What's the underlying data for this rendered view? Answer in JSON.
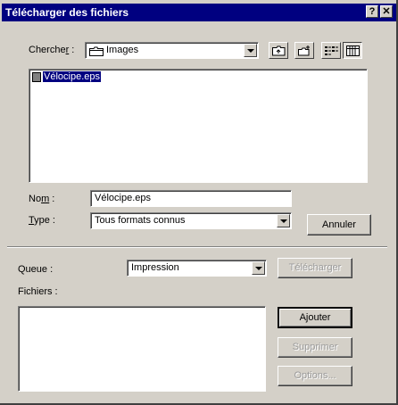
{
  "window": {
    "title": "Télécharger des fichiers",
    "help_glyph": "?",
    "close_glyph": "✕"
  },
  "lookin": {
    "label_pre": "Cherche",
    "label_key": "r",
    "label_post": " :",
    "value": "Images",
    "folder_icon": "folder-icon",
    "tool_icons": [
      "up-folder-icon",
      "new-folder-icon",
      "list-view-icon",
      "details-view-icon"
    ]
  },
  "files": {
    "items": [
      {
        "name": "Vélocipe.eps",
        "icon": "eps-file-icon",
        "selected": true
      }
    ]
  },
  "name": {
    "label_pre": "No",
    "label_key": "m",
    "label_post": " :",
    "value": "Vélocipe.eps"
  },
  "type": {
    "label_key": "T",
    "label_post": "ype :",
    "value": "Tous formats connus"
  },
  "buttons": {
    "cancel": "Annuler",
    "download": "Télécharger",
    "add": "Ajouter",
    "remove": "Supprimer",
    "options": "Options..."
  },
  "queue": {
    "label": "Queue :",
    "value": "Impression",
    "files_label": "Fichiers :"
  }
}
